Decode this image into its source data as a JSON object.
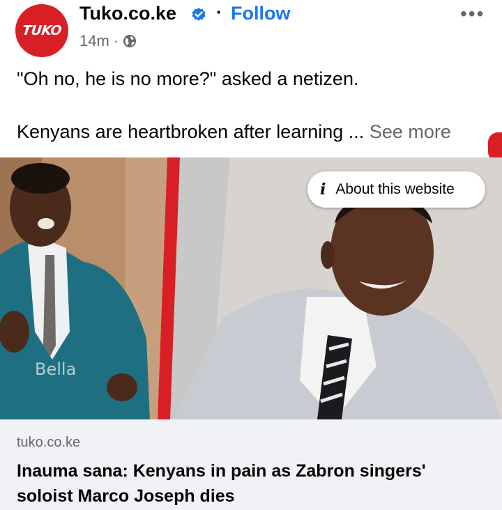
{
  "post": {
    "page_name": "Tuko.co.ke",
    "logo_text": "TUKO",
    "separator": "·",
    "follow_label": "Follow",
    "time": "14m",
    "meta_separator": "·",
    "audience_icon": "globe-icon",
    "more_icon": "•••",
    "text_line_1": "\"Oh no, he is no more?\" asked a netizen.",
    "text_line_2": "Kenyans are heartbroken after learning ...",
    "see_more_label": "See more"
  },
  "media": {
    "about_label": "About this website",
    "watermark": "Bella"
  },
  "link": {
    "domain": "tuko.co.ke",
    "headline": "Inauma sana: Kenyans in pain as Zabron singers' soloist Marco Joseph dies"
  },
  "colors": {
    "brand_red": "#d91f26",
    "link_blue": "#1877f2",
    "secondary_text": "#65676b",
    "footer_bg": "#f0f2f5"
  }
}
